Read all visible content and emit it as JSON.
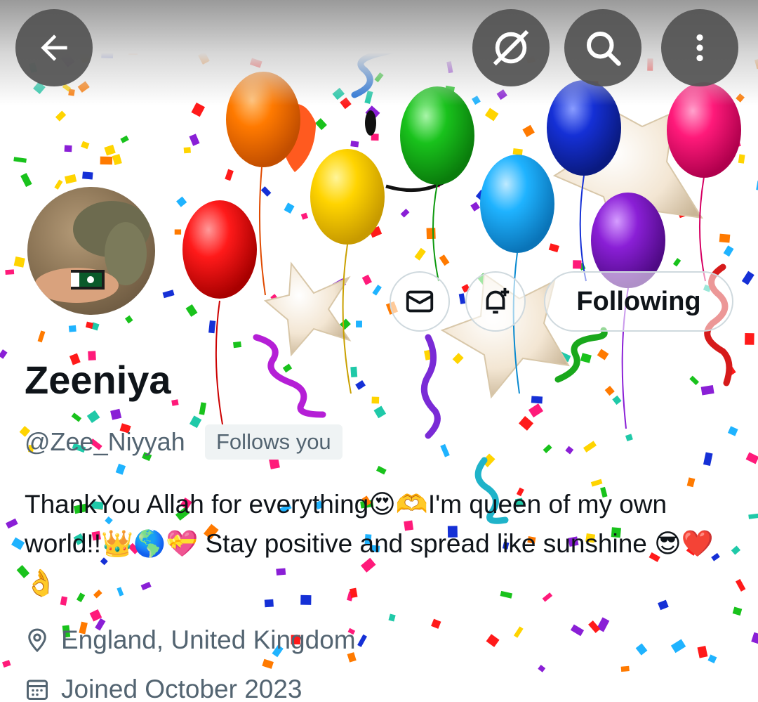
{
  "header": {
    "back_icon": "arrow-left-icon",
    "hide_icon": "eye-slash-icon",
    "search_icon": "search-icon",
    "more_icon": "more-vertical-icon"
  },
  "profile": {
    "display_name": "Zeeniya",
    "handle": "@Zee_Niyyah",
    "follows_you": "Follows you",
    "bio": "ThankYou Allah for everything😍🫶I'm queen of my own world!!👑🌎💝 Stay positive and spread like sunshine 😎❤️👌",
    "location": "England, United Kingdom",
    "joined": "Joined October 2023"
  },
  "actions": {
    "message_icon": "message-icon",
    "notification_icon": "bell-plus-icon",
    "following_label": "Following"
  },
  "colors": {
    "text_primary": "#0f1419",
    "text_secondary": "#536471",
    "border": "#cfd9de",
    "badge_bg": "#eff3f4",
    "balloons": [
      "#ff7a00",
      "#ffd400",
      "#ff1a1a",
      "#19c21c",
      "#1fb3ff",
      "#1530d6",
      "#8a1fd6",
      "#ff1a7a"
    ]
  }
}
